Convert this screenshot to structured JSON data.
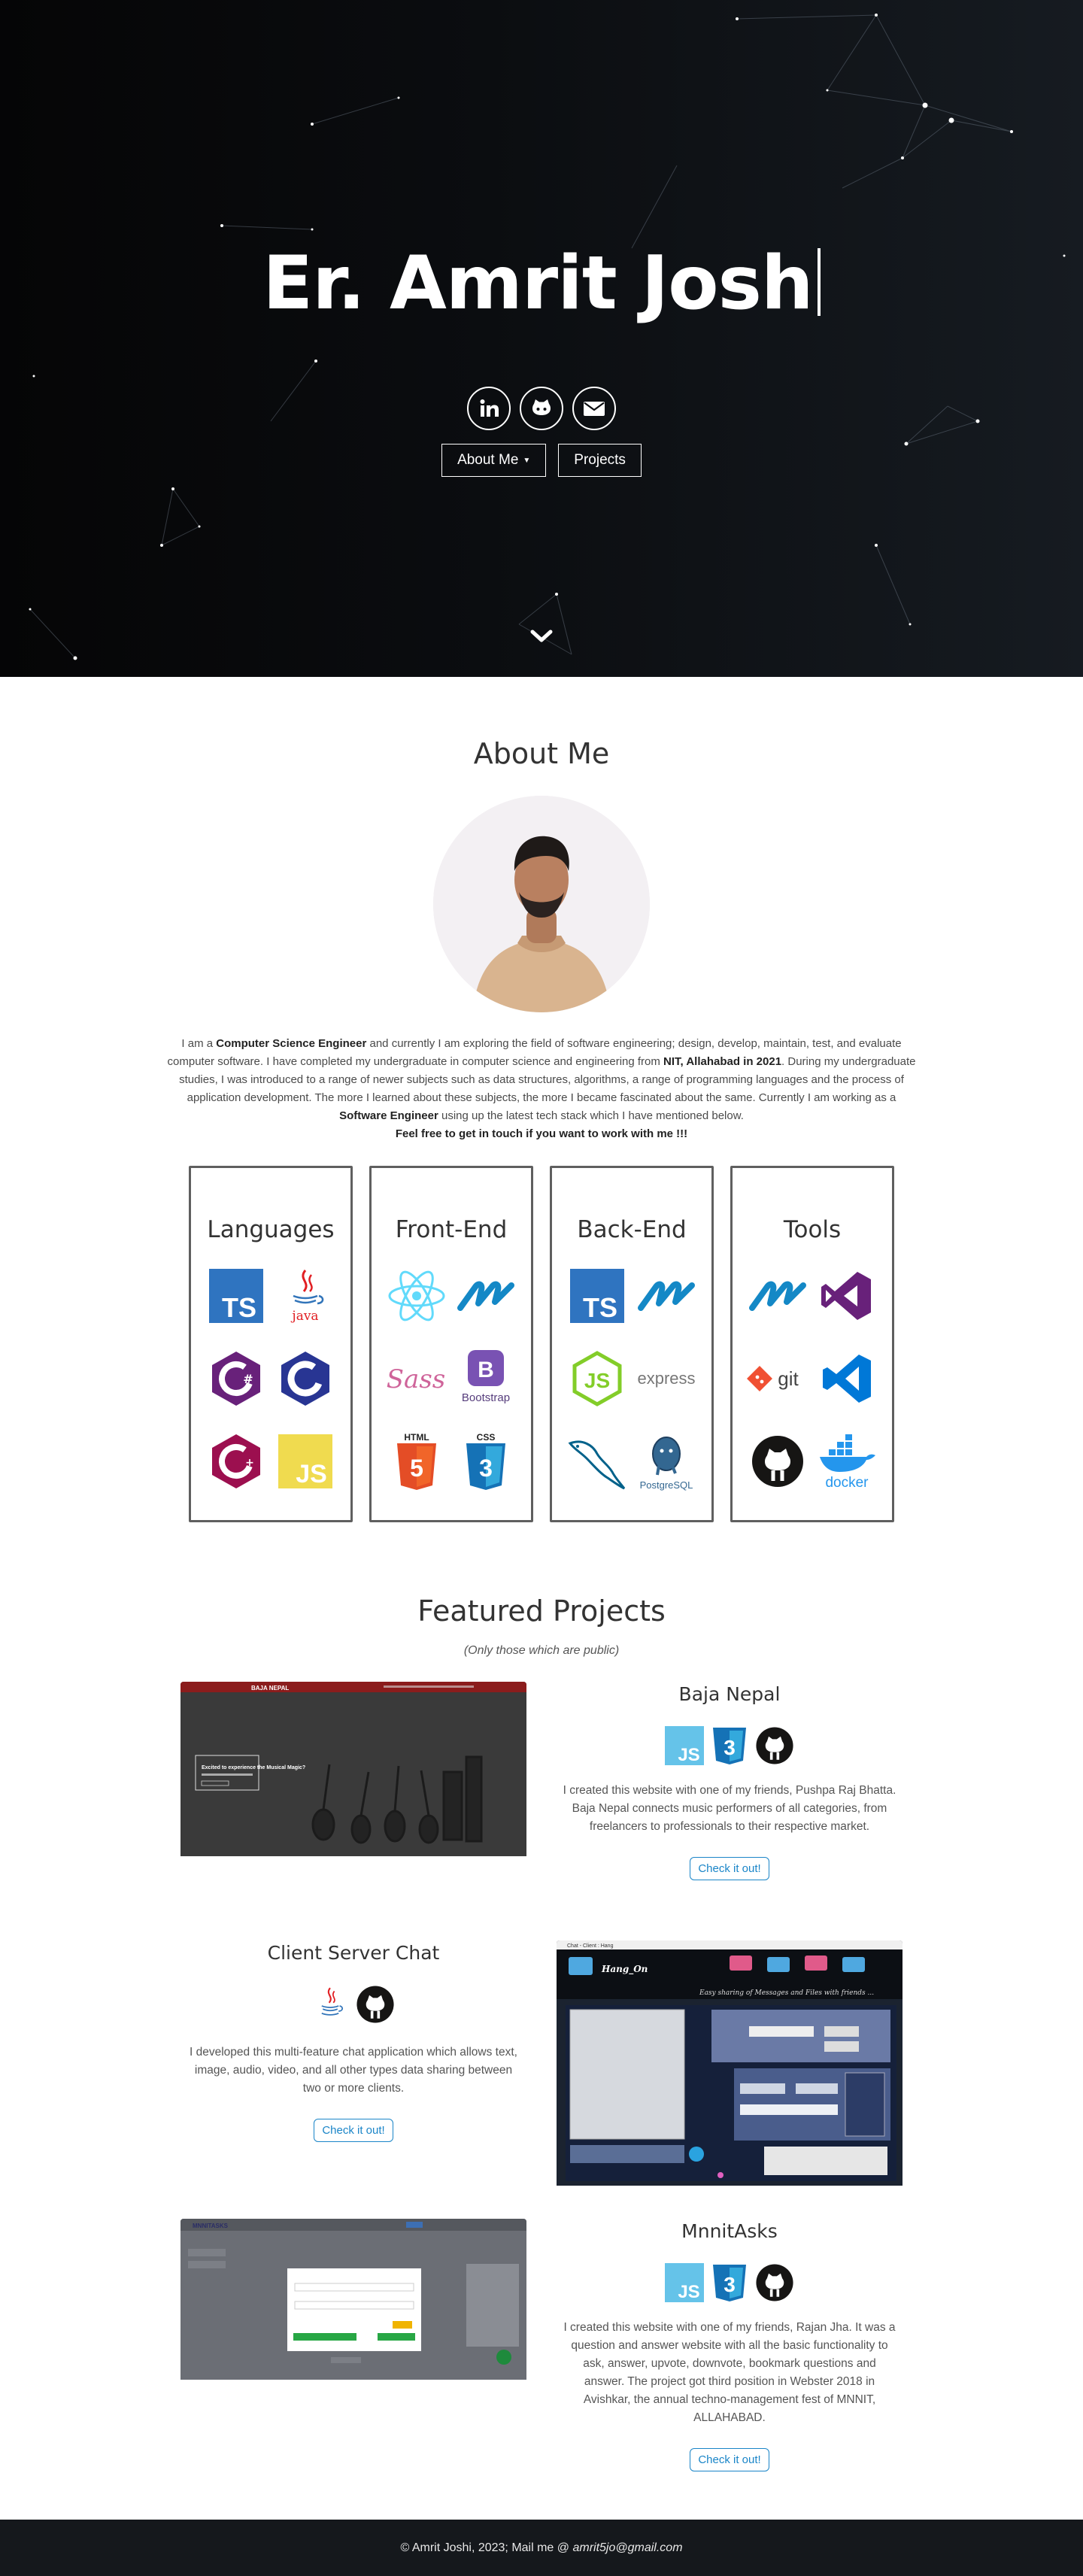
{
  "hero": {
    "title": "Er. Amrit Josh",
    "social": [
      {
        "icon": "linkedin-icon"
      },
      {
        "icon": "github-icon"
      },
      {
        "icon": "mail-icon"
      }
    ],
    "about_button": "About Me",
    "projects_button": "Projects",
    "colors": {
      "bg_start": "#050506",
      "bg_end": "#161b21",
      "text": "#ffffff"
    }
  },
  "about": {
    "title": "About Me",
    "p1_a": "I am a ",
    "p1_b": "Computer Science Engineer",
    "p1_c": " and currently I am exploring the field of software engineering; design, develop, maintain, test, and evaluate computer software. I have completed my undergraduate in computer science and engineering from ",
    "p1_d": "NIT, Allahabad in 2021",
    "p1_e": ". During my undergraduate studies, I was introduced to a range of newer subjects such as data structures, algorithms, a range of programming languages and the process of application development. The more I learned about these subjects, the more I became fascinated about the same. Currently I am working as a ",
    "p1_f": "Software Engineer",
    "p1_g": " using up the latest tech stack which I have mentioned below.",
    "cta": "Feel free to get in touch if you want to work with me !!!"
  },
  "skills": [
    {
      "title": "Languages",
      "icons": [
        "typescript-icon",
        "java-icon",
        "csharp-icon",
        "c-icon",
        "cplusplus-icon",
        "javascript-icon"
      ]
    },
    {
      "title": "Front-End",
      "icons": [
        "react-icon",
        "nextjs-icon",
        "sass-icon",
        "bootstrap-icon",
        "html5-icon",
        "css3-icon"
      ]
    },
    {
      "title": "Back-End",
      "icons": [
        "typescript-icon",
        "nextjs-icon",
        "nodejs-icon",
        "express-icon",
        "mysql-icon",
        "postgresql-icon"
      ]
    },
    {
      "title": "Tools",
      "icons": [
        "nextjs-icon",
        "visual-studio-icon",
        "git-icon",
        "vscode-icon",
        "github-icon",
        "docker-icon"
      ]
    }
  ],
  "skill_labels": {
    "java": "java",
    "bootstrap": "Bootstrap",
    "html": "HTML",
    "css": "CSS",
    "express": "express",
    "postgres": "PostgreSQL",
    "git": "git",
    "docker": "docker",
    "ts": "TS",
    "js": "JS"
  },
  "projects": {
    "title": "Featured Projects",
    "subtitle": "(Only those which are public)",
    "items": [
      {
        "name": "Baja Nepal",
        "icons": [
          "javascript-icon",
          "css3-icon",
          "github-icon"
        ],
        "description": "I created this website with one of my friends, Pushpa Raj Bhatta. Baja Nepal connects music performers of all categories, from freelancers to professionals to their respective market.",
        "button": "Check it out!",
        "shot": {
          "logo": "BAJA NEPAL",
          "headline": "Excited to experience the Musical Magic?"
        }
      },
      {
        "name": "Client Server Chat",
        "icons": [
          "java-icon",
          "github-icon"
        ],
        "description": "I developed this multi-feature chat application which allows text, image, audio, video, and all other types data sharing between two or more clients.",
        "button": "Check it out!",
        "shot": {
          "window_title": "Chat - Client : Hang",
          "app_name": "Hang_On",
          "tagline": "Easy sharing of Messages and Files with friends ..."
        }
      },
      {
        "name": "MnnitAsks",
        "icons": [
          "javascript-icon",
          "css3-icon",
          "github-icon"
        ],
        "description": "I created this website with one of my friends, Rajan Jha. It was a question and answer website with all the basic functionality to ask, answer, upvote, downvote, bookmark questions and answer. The project got third position in Webster 2018 in Avishkar, the annual techno-management fest of MNNIT, ALLAHABAD.",
        "button": "Check it out!",
        "shot": {
          "logo": "MNNITASKS"
        }
      }
    ]
  },
  "footer": {
    "text": "© Amrit Joshi, 2023; Mail me @ ",
    "email": "amrit5jo@gmail.com"
  }
}
